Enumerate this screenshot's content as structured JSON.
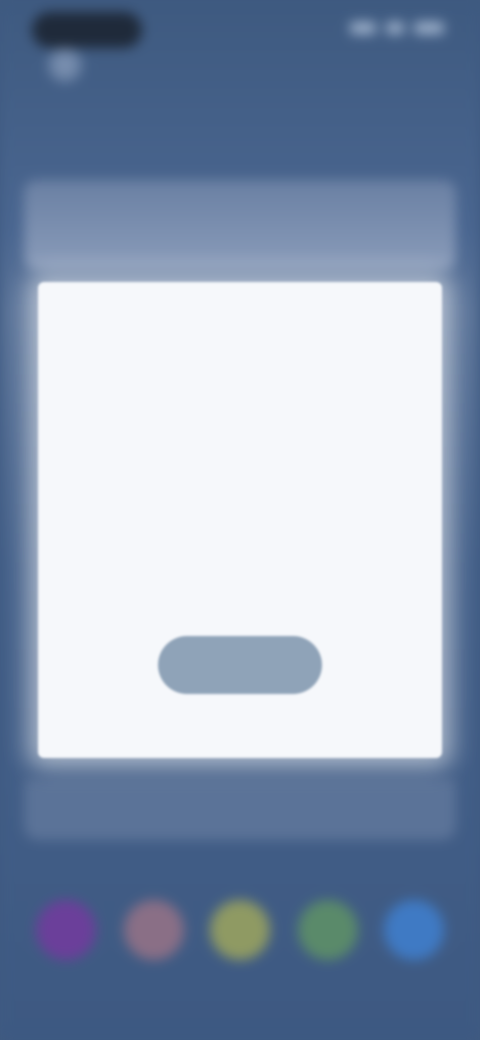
{
  "status_bar": {
    "icons": [
      "signal-icon",
      "wifi-icon",
      "battery-icon"
    ]
  },
  "header": {
    "back_glyph": "‹",
    "subtitle": ""
  },
  "modal": {
    "title": "",
    "body": "",
    "button_label": ""
  },
  "palette": {
    "swatches": [
      {
        "name": "purple",
        "color": "#6b3f9a"
      },
      {
        "name": "mauve",
        "color": "#8a6f86"
      },
      {
        "name": "olive",
        "color": "#8f9a63"
      },
      {
        "name": "green",
        "color": "#5a8a6a"
      },
      {
        "name": "blue",
        "color": "#3f7ac4"
      }
    ]
  },
  "colors": {
    "background": "#3f5a80",
    "modal": "#f6f8fb",
    "button": "#8fa3b8"
  }
}
